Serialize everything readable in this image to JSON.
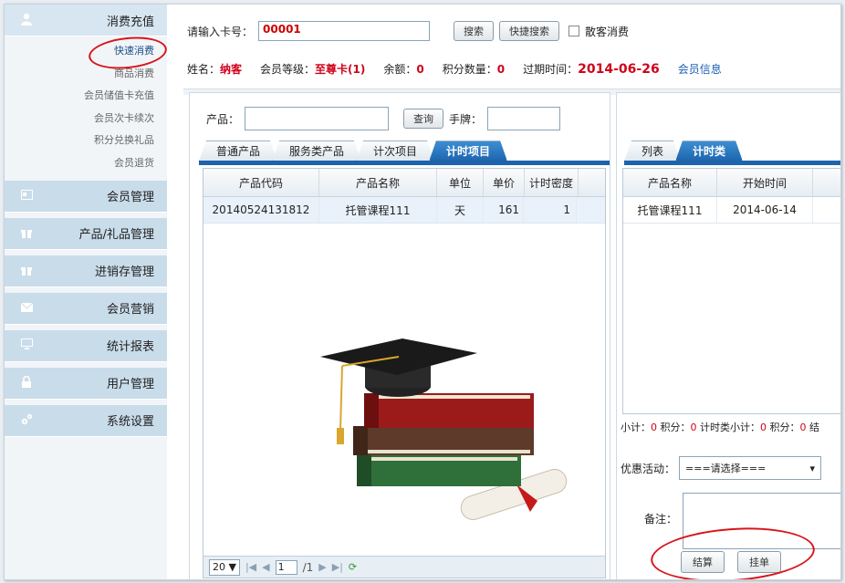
{
  "sidebar": {
    "sections": [
      {
        "label": "消费充值",
        "icon": "user-icon"
      },
      {
        "label": "会员管理",
        "icon": "card-icon"
      },
      {
        "label": "产品/礼品管理",
        "icon": "gift-icon"
      },
      {
        "label": "进销存管理",
        "icon": "gift-icon"
      },
      {
        "label": "会员营销",
        "icon": "mail-icon"
      },
      {
        "label": "统计报表",
        "icon": "monitor-icon"
      },
      {
        "label": "用户管理",
        "icon": "lock-icon"
      },
      {
        "label": "系统设置",
        "icon": "gears-icon"
      }
    ],
    "submenu": [
      "快速消费",
      "商品消费",
      "会员储值卡充值",
      "会员次卡续次",
      "积分兑换礼品",
      "会员退货"
    ]
  },
  "top": {
    "card_label": "请输入卡号：",
    "card_value": "00001",
    "search_btn": "搜索",
    "quick_search_btn": "快捷搜索",
    "guest_label": "散客消费",
    "name_label": "姓名：",
    "name_value": "纳客",
    "level_label": "会员等级：",
    "level_value": "至尊卡(1)",
    "balance_label": "余额：",
    "balance_value": "0",
    "points_label": "积分数量：",
    "points_value": "0",
    "expire_label": "过期时间：",
    "expire_value": "2014-06-26",
    "member_info_link": "会员信息"
  },
  "left": {
    "product_label": "产品：",
    "query_btn": "查询",
    "hand_label": "手牌：",
    "tabs": [
      "普通产品",
      "服务类产品",
      "计次项目",
      "计时项目"
    ],
    "columns": [
      "产品代码",
      "产品名称",
      "单位",
      "单价",
      "计时密度"
    ],
    "rows": [
      [
        "20140524131812",
        "托管课程111",
        "天",
        "161",
        "1"
      ]
    ],
    "pager": {
      "page_size": "20 ▼",
      "page": "1",
      "total": "/1"
    }
  },
  "right": {
    "tabs": [
      "列表",
      "计时类"
    ],
    "columns": [
      "产品名称",
      "开始时间"
    ],
    "rows": [
      [
        "托管课程111",
        "2014-06-14"
      ]
    ],
    "subtotal": {
      "l1": "小计：",
      "v1": "0",
      "l2": " 积分：",
      "v2": "0",
      "l3": " 计时类小计：",
      "v3": "0",
      "l4": " 积分：",
      "v4": "0",
      "l5": " 结"
    },
    "promo_label": "优惠活动：",
    "promo_value": "===请选择===",
    "note_label": "备注：",
    "settle_btn": "结算",
    "hold_btn": "挂单"
  }
}
